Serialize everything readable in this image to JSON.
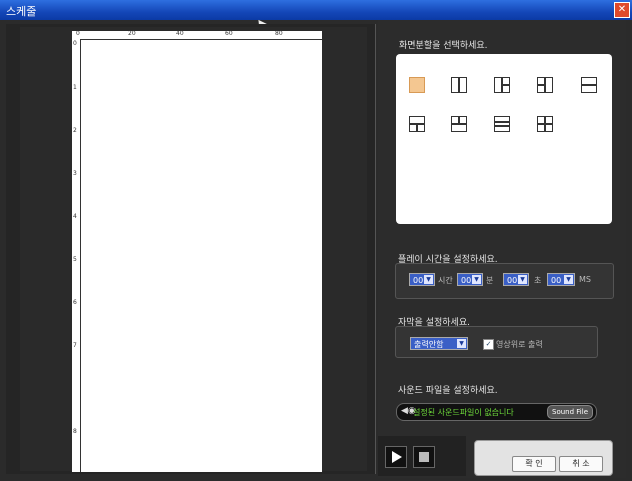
{
  "window": {
    "title": "스케줄",
    "close_icon": "close-icon"
  },
  "ruler": {
    "h_ticks": [
      "0",
      "20",
      "40",
      "60",
      "80"
    ],
    "v_ticks": [
      "0",
      "1",
      "2",
      "3",
      "4",
      "5",
      "6",
      "7",
      "8"
    ]
  },
  "layout": {
    "title": "화면분할을 선택하세요.",
    "selected": 0,
    "options": [
      "layout-1",
      "layout-2v",
      "layout-3a",
      "layout-3b",
      "layout-2h",
      "layout-3c",
      "layout-3d",
      "layout-3h",
      "layout-4"
    ]
  },
  "play_time": {
    "title": "플레이 시간을 설정하세요.",
    "hours": "00",
    "hours_unit": "시간",
    "minutes": "00",
    "minutes_unit": "분",
    "seconds": "00",
    "seconds_unit": "초",
    "ms": "00",
    "ms_unit": "MS"
  },
  "subtitle": {
    "title": "자막을 설정하세요.",
    "output": "출력안함",
    "on_video_label": "영상위로 출력",
    "on_video_checked": true
  },
  "sound": {
    "title": "사운드 파일을 설정하세요.",
    "status": "설정된 사운드파일이 없습니다",
    "button": "Sound File"
  },
  "footer": {
    "ok": "확 인",
    "cancel": "취 소"
  },
  "colors": {
    "titlebar": "#1447b8",
    "selected_layout": "#f4c791",
    "sound_text": "#6fdc3b"
  }
}
